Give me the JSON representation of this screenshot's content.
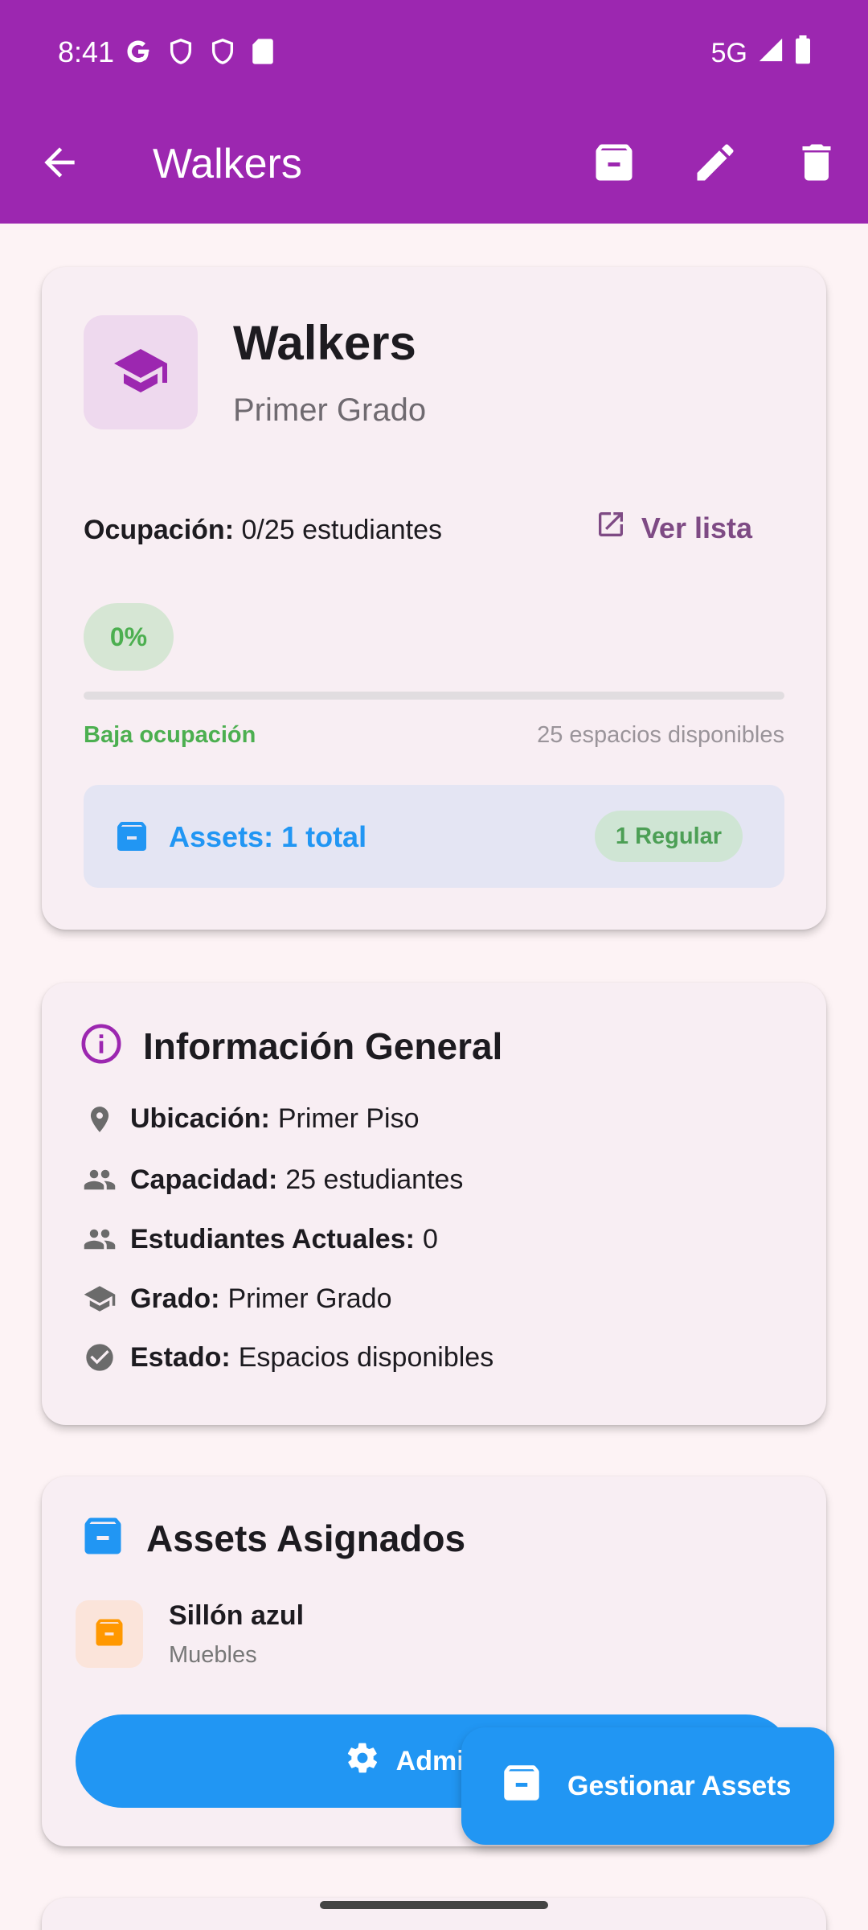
{
  "status_bar": {
    "time": "8:41",
    "network": "5G"
  },
  "app_bar": {
    "title": "Walkers"
  },
  "summary": {
    "name": "Walkers",
    "grade": "Primer Grado",
    "occupancy_label": "Ocupación:",
    "occupancy_value": "0/25 estudiantes",
    "view_list": "Ver lista",
    "percent": "0%",
    "progress": 0,
    "low_label": "Baja ocupación",
    "available": "25 espacios disponibles",
    "assets_label": "Assets: 1 total",
    "assets_badge": "1 Regular"
  },
  "info": {
    "title": "Información General",
    "rows": [
      {
        "label": "Ubicación:",
        "value": "Primer Piso",
        "icon": "location-pin-icon"
      },
      {
        "label": "Capacidad:",
        "value": "25 estudiantes",
        "icon": "people-icon"
      },
      {
        "label": "Estudiantes Actuales:",
        "value": "0",
        "icon": "people-icon"
      },
      {
        "label": "Grado:",
        "value": "Primer Grado",
        "icon": "graduation-cap-icon"
      },
      {
        "label": "Estado:",
        "value": "Espacios disponibles",
        "icon": "check-circle-icon"
      }
    ]
  },
  "assets": {
    "title": "Assets Asignados",
    "items": [
      {
        "name": "Sillón azul",
        "category": "Muebles"
      }
    ],
    "manage_button": "Administr"
  },
  "fab": {
    "label": "Gestionar Assets"
  },
  "colors": {
    "primary": "#9C27B0",
    "blue": "#2196F3",
    "green": "#4CAF50",
    "orange": "#FF9800",
    "background": "#FDF3F5"
  }
}
